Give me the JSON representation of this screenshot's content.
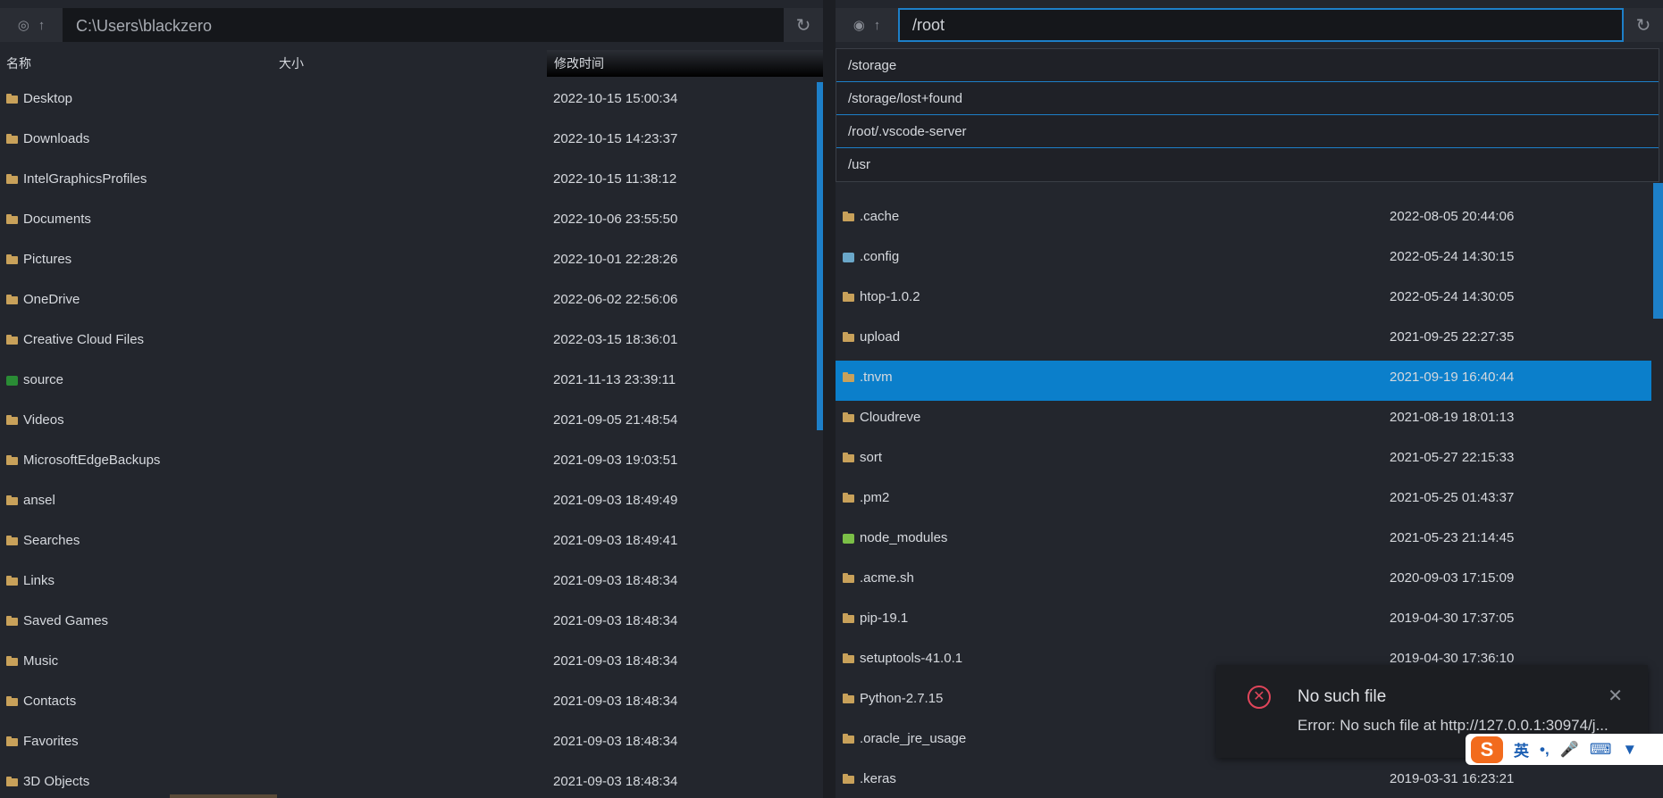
{
  "left": {
    "path": "C:\\Users\\blackzero",
    "columns": {
      "name": "名称",
      "size": "大小",
      "mtime": "修改时间"
    },
    "rows": [
      {
        "name": "Desktop",
        "mtime": "2022-10-15 15:00:34",
        "icon": "folder-icon"
      },
      {
        "name": "Downloads",
        "mtime": "2022-10-15 14:23:37",
        "icon": "folder-icon"
      },
      {
        "name": "IntelGraphicsProfiles",
        "mtime": "2022-10-15 11:38:12",
        "icon": "folder-icon"
      },
      {
        "name": "Documents",
        "mtime": "2022-10-06 23:55:50",
        "icon": "folder-icon"
      },
      {
        "name": "Pictures",
        "mtime": "2022-10-01 22:28:26",
        "icon": "folder-icon"
      },
      {
        "name": "OneDrive",
        "mtime": "2022-06-02 22:56:06",
        "icon": "folder-icon"
      },
      {
        "name": "Creative Cloud Files",
        "mtime": "2022-03-15 18:36:01",
        "icon": "folder-icon"
      },
      {
        "name": "source",
        "mtime": "2021-11-13 23:39:11",
        "icon": "git-folder-icon"
      },
      {
        "name": "Videos",
        "mtime": "2021-09-05 21:48:54",
        "icon": "folder-icon"
      },
      {
        "name": "MicrosoftEdgeBackups",
        "mtime": "2021-09-03 19:03:51",
        "icon": "folder-icon"
      },
      {
        "name": "ansel",
        "mtime": "2021-09-03 18:49:49",
        "icon": "folder-icon"
      },
      {
        "name": "Searches",
        "mtime": "2021-09-03 18:49:41",
        "icon": "folder-icon"
      },
      {
        "name": "Links",
        "mtime": "2021-09-03 18:48:34",
        "icon": "folder-icon"
      },
      {
        "name": "Saved Games",
        "mtime": "2021-09-03 18:48:34",
        "icon": "folder-icon"
      },
      {
        "name": "Music",
        "mtime": "2021-09-03 18:48:34",
        "icon": "folder-icon"
      },
      {
        "name": "Contacts",
        "mtime": "2021-09-03 18:48:34",
        "icon": "folder-icon"
      },
      {
        "name": "Favorites",
        "mtime": "2021-09-03 18:48:34",
        "icon": "folder-icon"
      },
      {
        "name": "3D Objects",
        "mtime": "2021-09-03 18:48:34",
        "icon": "folder-icon"
      }
    ]
  },
  "right": {
    "path": "/root",
    "suggestions": [
      "/storage",
      "/storage/lost+found",
      "/root/.vscode-server",
      "/usr"
    ],
    "rows": [
      {
        "name": ".cache",
        "mtime": "2022-08-05 20:44:06",
        "icon": "folder-icon"
      },
      {
        "name": ".config",
        "mtime": "2022-05-24 14:30:15",
        "icon": "config-folder-icon"
      },
      {
        "name": "htop-1.0.2",
        "mtime": "2022-05-24 14:30:05",
        "icon": "folder-icon"
      },
      {
        "name": "upload",
        "mtime": "2021-09-25 22:27:35",
        "icon": "folder-icon"
      },
      {
        "name": ".tnvm",
        "mtime": "2021-09-19 16:40:44",
        "icon": "folder-icon",
        "selected": true
      },
      {
        "name": "Cloudreve",
        "mtime": "2021-08-19 18:01:13",
        "icon": "folder-icon"
      },
      {
        "name": "sort",
        "mtime": "2021-05-27 22:15:33",
        "icon": "folder-icon"
      },
      {
        "name": ".pm2",
        "mtime": "2021-05-25 01:43:37",
        "icon": "folder-icon"
      },
      {
        "name": "node_modules",
        "mtime": "2021-05-23 21:14:45",
        "icon": "node-folder-icon"
      },
      {
        "name": ".acme.sh",
        "mtime": "2020-09-03 17:15:09",
        "icon": "folder-icon"
      },
      {
        "name": "pip-19.1",
        "mtime": "2019-04-30 17:37:05",
        "icon": "folder-icon"
      },
      {
        "name": "setuptools-41.0.1",
        "mtime": "2019-04-30 17:36:10",
        "icon": "folder-icon"
      },
      {
        "name": "Python-2.7.15",
        "mtime": "",
        "icon": "folder-icon"
      },
      {
        "name": ".oracle_jre_usage",
        "mtime": "",
        "icon": "folder-icon"
      },
      {
        "name": ".keras",
        "mtime": "2019-03-31 16:23:21",
        "icon": "folder-icon"
      }
    ]
  },
  "toast": {
    "title": "No such file",
    "message": "Error: No such file at http://127.0.0.1:30974/j..."
  },
  "ime": {
    "lang": "英",
    "punct": "•,"
  }
}
